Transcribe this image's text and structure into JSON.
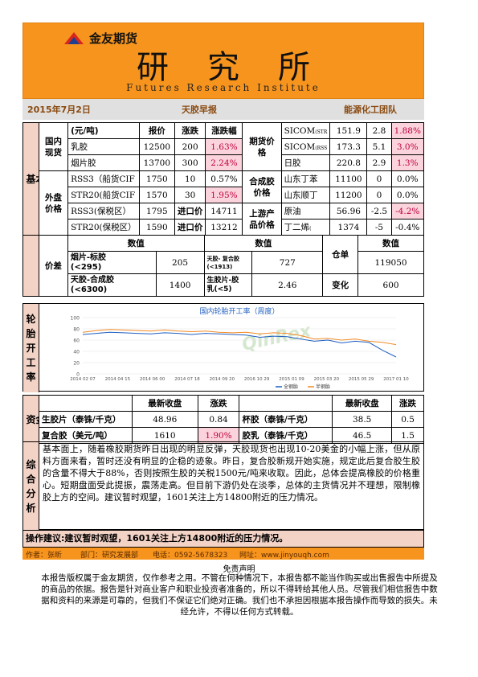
{
  "header": {
    "company": "金友期货",
    "title": "研究所",
    "subtitle_en": "Futures Research Institute",
    "colors": {
      "brand_orange": "#f7941d",
      "logo_red": "#d7261d",
      "logo_blue": "#1f3f8f"
    }
  },
  "meta": {
    "date": "2015年7月2日",
    "report": "天胶早报",
    "team": "能源化工团队"
  },
  "basic": {
    "section_label": "基本面",
    "domestic_label": "国内现货",
    "header": {
      "unit": "(元/吨)",
      "price": "报价",
      "change": "涨跌",
      "pct": "涨跌幅"
    },
    "domestic": [
      {
        "name": "乳胶",
        "price": "12500",
        "change": "200",
        "pct": "1.63%"
      },
      {
        "name": "烟片胶",
        "price": "13700",
        "change": "300",
        "pct": "2.24%"
      }
    ],
    "futures_label": "期货价格",
    "futures": [
      {
        "name": "SICOM",
        "sub": "(STR",
        "price": "151.9",
        "change": "2.8",
        "pct": "1.88%"
      },
      {
        "name": "SICOM",
        "sub": "(RSS",
        "price": "173.3",
        "change": "5.1",
        "pct": "3.0%"
      },
      {
        "name": "日胶",
        "sub": "",
        "price": "220.8",
        "change": "2.9",
        "pct": "1.3%"
      }
    ],
    "foreign_label": "外盘价格",
    "foreign": [
      {
        "name": "RSS3（船货CIF",
        "price": "1750",
        "change": "10",
        "pct": "0.57%"
      },
      {
        "name": "STR20(船货CIF",
        "price": "1570",
        "change": "30",
        "pct": "1.95%"
      },
      {
        "name": "RSS3(保税区）",
        "price": "1795",
        "label": "进口价",
        "value": "14711"
      },
      {
        "name": "STR20(保税区）",
        "price": "1590",
        "label": "进口价",
        "value": "13212"
      }
    ],
    "synthetic_label": "合成胶价格",
    "synthetic": [
      {
        "name": "山东丁苯",
        "price": "11100",
        "change": "0",
        "pct": "0.0%"
      },
      {
        "name": "山东顺丁",
        "price": "11200",
        "change": "0",
        "pct": "0.0%"
      }
    ],
    "upstream_label": "上游产品价格",
    "upstream": [
      {
        "name": "原油",
        "sub": "",
        "price": "56.96",
        "change": "-2.5",
        "pct": "-4.2%"
      },
      {
        "name": "丁二烯",
        "sub": "(",
        "price": "1374",
        "change": "-5",
        "pct": "-0.4%"
      }
    ],
    "spread_label": "价差",
    "value_label": "数值",
    "spreads": [
      {
        "name": "烟片-标胶",
        "cond": "(<295)",
        "value": "205"
      },
      {
        "name": "天胶-合成胶",
        "cond": "(<6300)",
        "value": "1400"
      }
    ],
    "spreads2": [
      {
        "name": "天胶- 复合胶",
        "cond": "(<1913)",
        "value": "727"
      },
      {
        "name": "生胶片-胶",
        "cond": "乳(<5)",
        "value": "2.46"
      }
    ],
    "warehouse_label": "仓单",
    "warehouse_value": "119050",
    "change_label": "变化",
    "change_value": "600"
  },
  "tire": {
    "section_label": "轮胎开工率",
    "chart_title": "国内轮胎开工率（周度）",
    "watermark": "QinRex"
  },
  "chart_data": {
    "type": "line",
    "title": "国内轮胎开工率（周度）",
    "ylim": [
      0,
      100
    ],
    "y_ticks": [
      "0",
      "20",
      "40",
      "60",
      "80",
      "100"
    ],
    "x_ticks": [
      "2014 02 07",
      "2014 04 15",
      "2014 06 00",
      "2014 07 18",
      "2014 09 20",
      "2016 10 29",
      "2015 01 09",
      "2015 03 20",
      "2015 05 29",
      "2017 01 10"
    ],
    "series": [
      {
        "name": "全钢胎",
        "color": "#1f5fbf",
        "values": [
          70,
          72,
          74,
          73,
          72,
          71,
          73,
          72,
          70,
          72,
          71,
          70,
          69,
          65,
          67,
          66,
          62,
          58,
          60,
          55,
          58,
          56,
          42,
          30
        ]
      },
      {
        "name": "半钢胎",
        "color": "#f28a24",
        "values": [
          74,
          77,
          79,
          78,
          77,
          76,
          78,
          76,
          75,
          76,
          74,
          73,
          74,
          71,
          73,
          72,
          68,
          62,
          63,
          60,
          62,
          58,
          56,
          52
        ]
      }
    ]
  },
  "yield": {
    "section_label": "资金面",
    "header_close": "最新收盘",
    "header_change": "涨跌",
    "rows": [
      {
        "name": "生胶片（泰铢/千克）",
        "close": "48.96",
        "change": "0.84",
        "name2": "杯胶（泰铢/千克）",
        "close2": "38.5",
        "change2": "0.5"
      },
      {
        "name": "复合胶（美元/吨）",
        "close": "1610",
        "change": "1.90%",
        "name2": "胶乳（泰铢/千克）",
        "close2": "46.5",
        "change2": "1.5"
      }
    ]
  },
  "analysis": {
    "section_label": "综合分析",
    "text": "基本面上，随着橡胶期货昨日出现的明显反弹，天胶现货也出现10-20美金的小幅上涨，但从原料方面来看，暂时还没有明显的企稳的迹象。昨日，复合胶新规开始实施，规定此后复合胶生胶的含量不得大于88%，否则按照生胶的关税1500元/吨来收取。因此，总体会提高橡胶的价格重心。短期盘面受此提振，震荡走高。但目前下游仍处在淡季，总体的主货情况并不理想，限制橡胶上方的空间。建议暂时观望，1601关注上方14800附近的压力情况。"
  },
  "advice": "操作建议:建议暂时观望，1601关注上方14800附近的压力情况。",
  "footer": {
    "author": "作者：张昕",
    "dept": "部门：研究发展部",
    "phone": "电话：0592-5678323",
    "site": "网址：www.jinyouqh.com"
  },
  "disclaimer": {
    "title": "免责声明",
    "text": "本报告版权属于金友期货，仅作参考之用。不管在何种情况下，本报告都不能当作购买或出售报告中所提及的商品的依据。报告是针对商业客户和职业投资者准备的，所以不得转给其他人员。尽管我们相信报告中数据和资料的来源是可靠的，但我们不保证它们绝对正确。我们也不承担因根据本报告操作而导致的损失。未经允许，不得以任何方式转载。"
  }
}
